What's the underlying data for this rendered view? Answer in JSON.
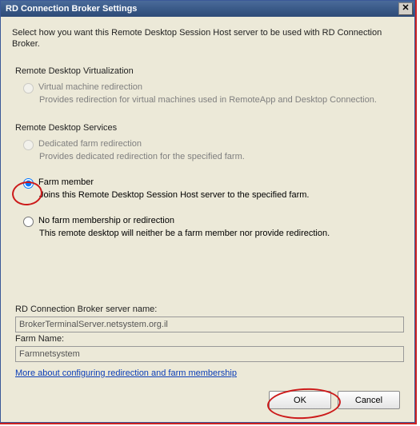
{
  "titlebar": {
    "title": "RD Connection Broker Settings",
    "close_glyph": "✕"
  },
  "intro": "Select how you want this Remote Desktop Session Host server to be used with RD Connection Broker.",
  "sections": {
    "virtualization_heading": "Remote Desktop Virtualization",
    "services_heading": "Remote Desktop Services"
  },
  "options": {
    "vm_redir": {
      "label": "Virtual machine redirection",
      "desc": "Provides redirection for virtual machines used in RemoteApp and Desktop Connection."
    },
    "dedicated_farm": {
      "label": "Dedicated farm redirection",
      "desc": "Provides dedicated redirection for the specified farm."
    },
    "farm_member": {
      "label": "Farm member",
      "desc": "Joins this Remote Desktop Session Host server to the specified farm."
    },
    "no_membership": {
      "label": "No farm membership or redirection",
      "desc": "This remote desktop will neither be a farm member nor provide redirection."
    }
  },
  "fields": {
    "broker_name_label": "RD Connection Broker server name:",
    "broker_name_value": "BrokerTerminalServer.netsystem.org.il",
    "farm_name_label": "Farm Name:",
    "farm_name_value": "Farmnetsystem"
  },
  "link_text": "More about configuring redirection and farm membership",
  "buttons": {
    "ok": "OK",
    "cancel": "Cancel"
  }
}
